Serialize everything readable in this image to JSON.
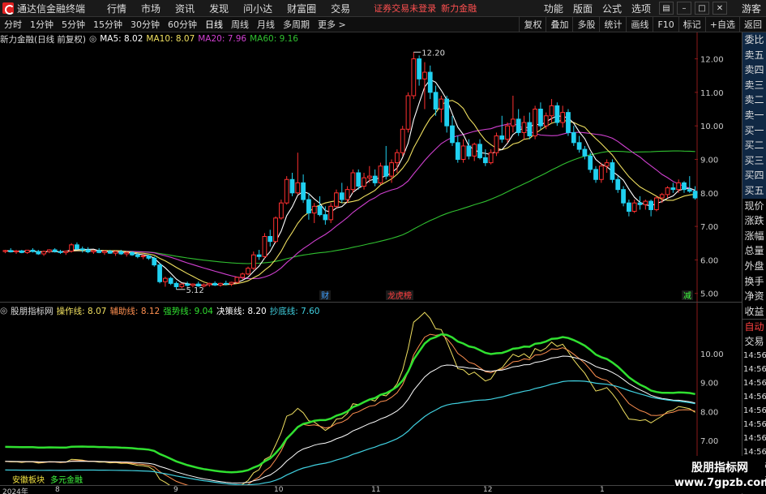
{
  "menubar": {
    "app_title": "通达信金融终端",
    "items": [
      "行情",
      "市场",
      "资讯",
      "发现",
      "问小达",
      "财富圈",
      "交易"
    ],
    "login_status": "证券交易未登录",
    "stock_name": "新力金融",
    "right_items": [
      "功能",
      "版面",
      "公式",
      "选项"
    ],
    "guest": "游客"
  },
  "toolbar": {
    "periods": [
      "分时",
      "1分钟",
      "5分钟",
      "15分钟",
      "30分钟",
      "60分钟",
      "日线",
      "周线",
      "月线",
      "多周期",
      "更多 >"
    ],
    "active": "日线",
    "right_buttons": [
      "复权",
      "叠加",
      "多股",
      "统计",
      "画线",
      "F10",
      "标记",
      "+自选",
      "返回"
    ]
  },
  "main_legend": {
    "title": "新力金融(日线 前复权)",
    "ma5": "MA5: 8.02",
    "ma10": "MA10: 8.07",
    "ma20": "MA20: 7.96",
    "ma60": "MA60: 9.16",
    "colors": {
      "ma5": "#ffffff",
      "ma10": "#f0e060",
      "ma20": "#d040d0",
      "ma60": "#30c030"
    }
  },
  "indicator_legend": {
    "title": "股朋指标网",
    "l1": "操作线: 8.07",
    "l2": "辅助线: 8.12",
    "l3": "强势线: 9.04",
    "l4": "决策线: 8.20",
    "l5": "抄底线: 7.60"
  },
  "main_axis": [
    "12.00",
    "11.00",
    "10.00",
    "9.00",
    "8.00",
    "7.00",
    "6.00",
    "5.00"
  ],
  "ind_axis": [
    "10.00",
    "9.00",
    "8.00",
    "7.00"
  ],
  "annotations": {
    "high": "12.20",
    "low": "5.12",
    "mark1": "财",
    "mark2": "龙虎榜",
    "mark3": "减"
  },
  "right_panel": {
    "items": [
      "委比",
      "卖五",
      "卖四",
      "卖三",
      "卖二",
      "卖一",
      "买一",
      "买二",
      "买三",
      "买四",
      "买五",
      "现价",
      "涨跌",
      "涨幅",
      "总量",
      "外盘",
      "换手",
      "净资",
      "收益"
    ],
    "trade": [
      "自动",
      "交易"
    ],
    "times": [
      "14:56",
      "14:56",
      "14:56",
      "14:56",
      "14:56",
      "14:56",
      "14:56",
      "14:56",
      "14:56",
      "14:56"
    ]
  },
  "bottom": {
    "year": "2024年",
    "months": [
      "8",
      "9",
      "10",
      "11",
      "12",
      "1"
    ],
    "sector_label": "安徽板块",
    "sector_name": "多元金融"
  },
  "watermark": {
    "line1": "股朋指标网",
    "line2": "www.7gpzb.com"
  },
  "chart_data": {
    "type": "candlestick",
    "title": "新力金融(日线 前复权)",
    "ylim": [
      4.8,
      12.4
    ],
    "candles": [
      [
        6.25,
        6.3,
        6.2,
        6.28
      ],
      [
        6.28,
        6.35,
        6.22,
        6.24
      ],
      [
        6.24,
        6.3,
        6.18,
        6.27
      ],
      [
        6.27,
        6.3,
        6.2,
        6.22
      ],
      [
        6.22,
        6.3,
        6.18,
        6.29
      ],
      [
        6.29,
        6.35,
        6.22,
        6.25
      ],
      [
        6.25,
        6.3,
        6.15,
        6.18
      ],
      [
        6.18,
        6.28,
        6.12,
        6.25
      ],
      [
        6.25,
        6.32,
        6.2,
        6.3
      ],
      [
        6.3,
        6.35,
        6.22,
        6.25
      ],
      [
        6.25,
        6.3,
        6.18,
        6.22
      ],
      [
        6.22,
        6.28,
        6.15,
        6.26
      ],
      [
        6.26,
        6.5,
        6.22,
        6.45
      ],
      [
        6.45,
        6.52,
        6.3,
        6.33
      ],
      [
        6.33,
        6.4,
        6.22,
        6.3
      ],
      [
        6.3,
        6.38,
        6.2,
        6.24
      ],
      [
        6.24,
        6.3,
        6.18,
        6.28
      ],
      [
        6.28,
        6.35,
        6.2,
        6.22
      ],
      [
        6.22,
        6.3,
        6.15,
        6.26
      ],
      [
        6.26,
        6.3,
        6.18,
        6.2
      ],
      [
        6.2,
        6.28,
        6.12,
        6.25
      ],
      [
        6.25,
        6.3,
        6.15,
        6.18
      ],
      [
        6.18,
        6.25,
        6.1,
        6.22
      ],
      [
        6.22,
        6.26,
        6.12,
        6.15
      ],
      [
        6.15,
        6.2,
        6.05,
        6.1
      ],
      [
        6.1,
        6.18,
        6.02,
        6.12
      ],
      [
        6.12,
        6.15,
        6.0,
        6.05
      ],
      [
        6.05,
        6.1,
        5.8,
        5.85
      ],
      [
        5.85,
        5.9,
        5.3,
        5.35
      ],
      [
        5.35,
        5.5,
        5.2,
        5.45
      ],
      [
        5.45,
        5.5,
        5.25,
        5.3
      ],
      [
        5.3,
        5.35,
        5.12,
        5.2
      ],
      [
        5.2,
        5.3,
        5.15,
        5.28
      ],
      [
        5.28,
        5.35,
        5.2,
        5.24
      ],
      [
        5.24,
        5.3,
        5.18,
        5.28
      ],
      [
        5.28,
        5.35,
        5.2,
        5.22
      ],
      [
        5.22,
        5.3,
        5.18,
        5.26
      ],
      [
        5.26,
        5.32,
        5.2,
        5.3
      ],
      [
        5.3,
        5.36,
        5.22,
        5.25
      ],
      [
        5.25,
        5.32,
        5.2,
        5.3
      ],
      [
        5.3,
        5.38,
        5.24,
        5.28
      ],
      [
        5.28,
        5.35,
        5.22,
        5.33
      ],
      [
        5.33,
        5.5,
        5.3,
        5.48
      ],
      [
        5.48,
        5.62,
        5.42,
        5.58
      ],
      [
        5.58,
        5.8,
        5.55,
        5.75
      ],
      [
        5.75,
        6.25,
        5.7,
        6.15
      ],
      [
        6.15,
        6.3,
        6.0,
        6.1
      ],
      [
        6.1,
        6.8,
        6.05,
        6.7
      ],
      [
        6.7,
        6.9,
        6.4,
        6.55
      ],
      [
        6.55,
        7.3,
        6.5,
        7.25
      ],
      [
        7.25,
        7.8,
        7.2,
        7.7
      ],
      [
        7.7,
        8.5,
        7.65,
        8.4
      ],
      [
        8.4,
        8.6,
        7.9,
        8.0
      ],
      [
        8.0,
        9.2,
        7.95,
        8.3
      ],
      [
        8.3,
        8.55,
        7.7,
        7.8
      ],
      [
        7.8,
        8.0,
        7.2,
        7.4
      ],
      [
        7.4,
        7.7,
        7.1,
        7.6
      ],
      [
        7.6,
        7.9,
        7.3,
        7.35
      ],
      [
        7.35,
        7.6,
        7.05,
        7.2
      ],
      [
        7.2,
        7.7,
        7.1,
        7.6
      ],
      [
        7.6,
        8.1,
        7.55,
        8.0
      ],
      [
        8.0,
        8.3,
        7.7,
        7.8
      ],
      [
        7.8,
        8.2,
        7.7,
        8.1
      ],
      [
        8.1,
        8.7,
        8.0,
        8.6
      ],
      [
        8.6,
        8.7,
        8.1,
        8.2
      ],
      [
        8.2,
        8.6,
        8.1,
        8.45
      ],
      [
        8.45,
        8.8,
        8.3,
        8.5
      ],
      [
        8.5,
        8.7,
        8.2,
        8.3
      ],
      [
        8.3,
        8.9,
        8.25,
        8.8
      ],
      [
        8.8,
        9.4,
        8.4,
        8.5
      ],
      [
        8.5,
        9.0,
        8.3,
        8.9
      ],
      [
        8.9,
        9.3,
        8.6,
        9.2
      ],
      [
        9.2,
        10.0,
        9.1,
        9.9
      ],
      [
        9.9,
        11.0,
        9.8,
        10.9
      ],
      [
        10.9,
        12.2,
        10.8,
        12.0
      ],
      [
        12.0,
        12.1,
        11.2,
        11.4
      ],
      [
        11.4,
        11.9,
        10.5,
        11.6
      ],
      [
        11.6,
        11.8,
        10.8,
        11.0
      ],
      [
        11.0,
        11.2,
        10.3,
        10.5
      ],
      [
        10.5,
        10.9,
        10.1,
        10.8
      ],
      [
        10.8,
        10.9,
        9.8,
        10.0
      ],
      [
        10.0,
        10.3,
        9.4,
        9.5
      ],
      [
        9.5,
        9.7,
        8.9,
        9.0
      ],
      [
        9.0,
        9.6,
        8.9,
        9.4
      ],
      [
        9.4,
        9.6,
        9.0,
        9.1
      ],
      [
        9.1,
        9.5,
        8.95,
        9.45
      ],
      [
        9.45,
        9.6,
        9.0,
        9.05
      ],
      [
        9.05,
        9.3,
        8.8,
        8.9
      ],
      [
        8.9,
        9.3,
        8.85,
        9.2
      ],
      [
        9.2,
        9.8,
        9.1,
        9.7
      ],
      [
        9.7,
        10.3,
        9.5,
        9.6
      ],
      [
        9.6,
        10.1,
        9.5,
        10.0
      ],
      [
        10.0,
        10.9,
        9.8,
        10.2
      ],
      [
        10.2,
        10.5,
        9.7,
        9.8
      ],
      [
        9.8,
        10.3,
        9.6,
        10.1
      ],
      [
        10.1,
        10.4,
        9.6,
        9.7
      ],
      [
        9.7,
        10.6,
        9.6,
        10.5
      ],
      [
        10.5,
        10.7,
        9.9,
        10.0
      ],
      [
        10.0,
        10.4,
        9.9,
        10.3
      ],
      [
        10.3,
        10.8,
        10.1,
        10.6
      ],
      [
        10.6,
        10.7,
        10.0,
        10.1
      ],
      [
        10.1,
        10.6,
        9.95,
        10.4
      ],
      [
        10.4,
        10.5,
        9.7,
        9.8
      ],
      [
        9.8,
        10.0,
        9.4,
        9.5
      ],
      [
        9.5,
        9.7,
        9.2,
        9.3
      ],
      [
        9.3,
        9.4,
        9.0,
        9.1
      ],
      [
        9.1,
        9.2,
        8.6,
        8.7
      ],
      [
        8.7,
        8.8,
        8.3,
        8.4
      ],
      [
        8.4,
        8.9,
        8.3,
        8.8
      ],
      [
        8.8,
        9.0,
        8.6,
        8.9
      ],
      [
        8.9,
        9.0,
        8.3,
        8.4
      ],
      [
        8.4,
        8.5,
        8.0,
        8.1
      ],
      [
        8.1,
        8.2,
        7.6,
        7.7
      ],
      [
        7.7,
        7.8,
        7.3,
        7.45
      ],
      [
        7.45,
        7.8,
        7.4,
        7.7
      ],
      [
        7.7,
        7.9,
        7.5,
        7.65
      ],
      [
        7.65,
        7.8,
        7.5,
        7.75
      ],
      [
        7.75,
        7.8,
        7.3,
        7.5
      ],
      [
        7.5,
        7.9,
        7.45,
        7.85
      ],
      [
        7.85,
        8.0,
        7.7,
        7.95
      ],
      [
        7.95,
        8.2,
        7.85,
        8.15
      ],
      [
        8.15,
        8.3,
        8.0,
        8.1
      ],
      [
        8.1,
        8.4,
        8.0,
        8.3
      ],
      [
        8.3,
        8.35,
        8.0,
        8.1
      ],
      [
        8.1,
        8.5,
        8.0,
        8.05
      ],
      [
        8.05,
        8.2,
        7.8,
        7.85
      ]
    ]
  }
}
